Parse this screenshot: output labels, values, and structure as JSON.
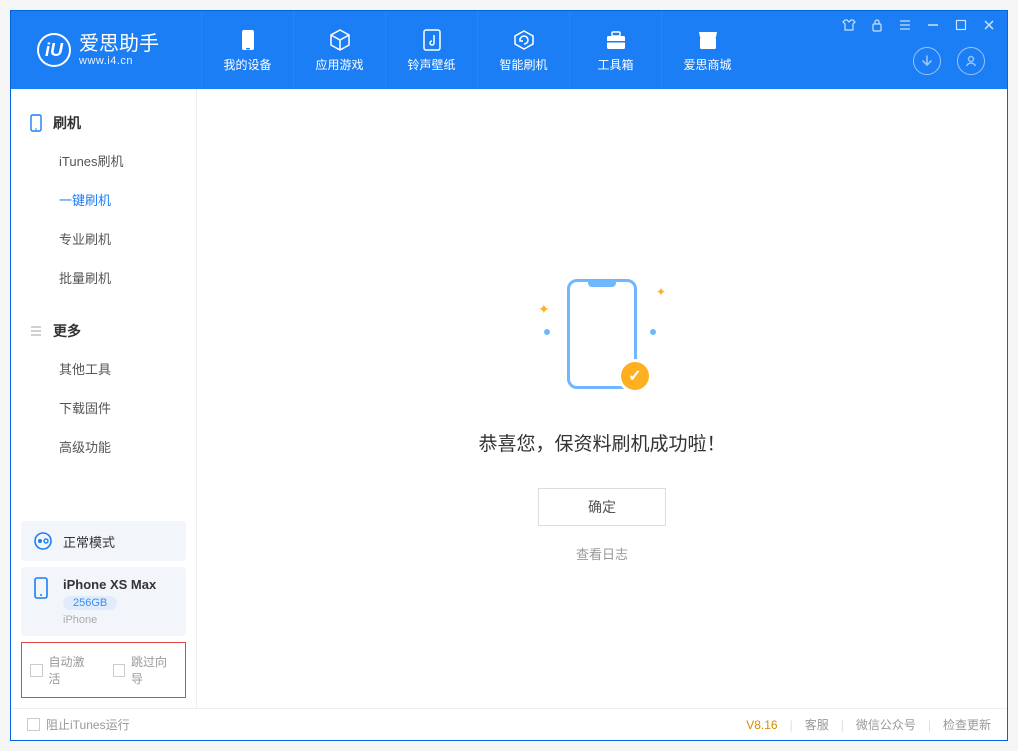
{
  "app": {
    "title": "爱思助手",
    "subtitle": "www.i4.cn"
  },
  "nav": {
    "tabs": [
      {
        "label": "我的设备"
      },
      {
        "label": "应用游戏"
      },
      {
        "label": "铃声壁纸"
      },
      {
        "label": "智能刷机"
      },
      {
        "label": "工具箱"
      },
      {
        "label": "爱思商城"
      }
    ]
  },
  "sidebar": {
    "group1": {
      "title": "刷机",
      "items": [
        {
          "label": "iTunes刷机"
        },
        {
          "label": "一键刷机"
        },
        {
          "label": "专业刷机"
        },
        {
          "label": "批量刷机"
        }
      ]
    },
    "group2": {
      "title": "更多",
      "items": [
        {
          "label": "其他工具"
        },
        {
          "label": "下载固件"
        },
        {
          "label": "高级功能"
        }
      ]
    },
    "mode": {
      "label": "正常模式"
    },
    "device": {
      "name": "iPhone XS Max",
      "capacity": "256GB",
      "type": "iPhone"
    },
    "checkboxes": {
      "auto_activate": "自动激活",
      "skip_guide": "跳过向导"
    }
  },
  "main": {
    "success_message": "恭喜您，保资料刷机成功啦！",
    "ok_button": "确定",
    "view_log": "查看日志"
  },
  "footer": {
    "stop_itunes": "阻止iTunes运行",
    "version": "V8.16",
    "links": {
      "support": "客服",
      "wechat": "微信公众号",
      "check_update": "检查更新"
    }
  }
}
